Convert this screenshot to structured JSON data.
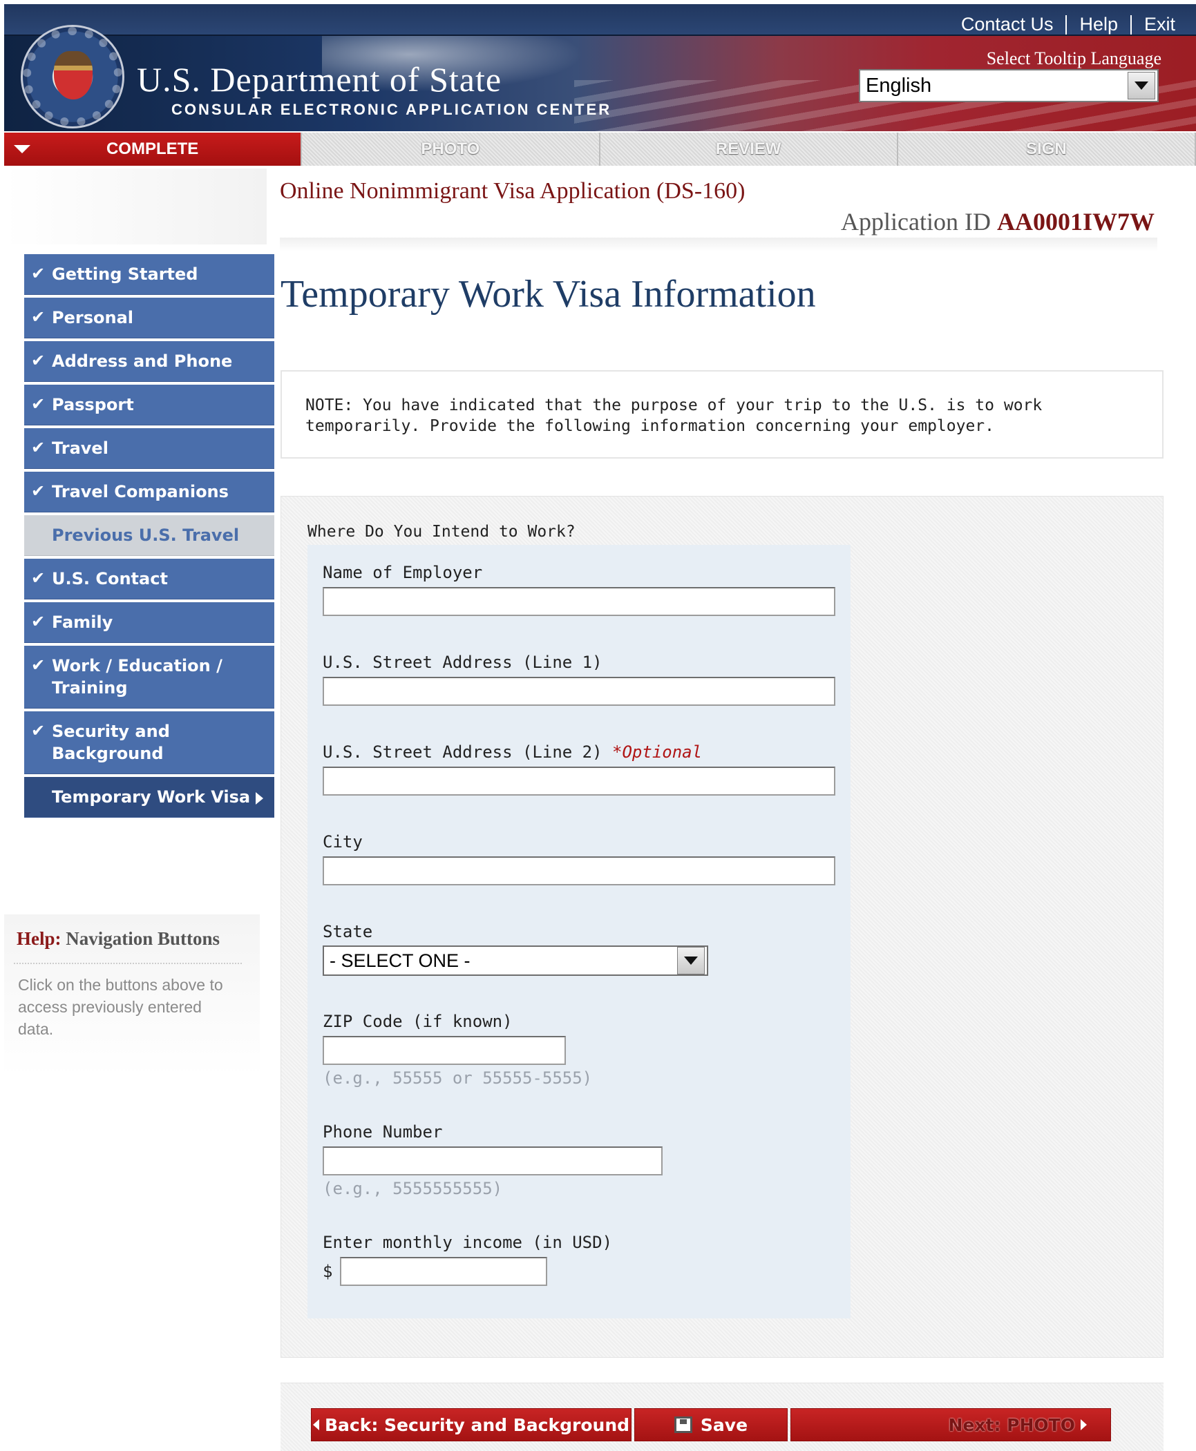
{
  "header": {
    "top_links": [
      "Contact Us",
      "Help",
      "Exit"
    ],
    "dept_title": "U.S. Department of State",
    "dept_subtitle": "CONSULAR ELECTRONIC APPLICATION CENTER",
    "tooltip_label": "Select Tooltip Language",
    "tooltip_language": "English"
  },
  "steps": [
    "COMPLETE",
    "PHOTO",
    "REVIEW",
    "SIGN"
  ],
  "title": {
    "form_name": "Online Nonimmigrant Visa Application (DS-160)",
    "app_id_label": "Application ID",
    "app_id": "AA0001IW7W"
  },
  "sidebar": {
    "items": [
      {
        "label": "Getting Started",
        "state": "done"
      },
      {
        "label": "Personal",
        "state": "done"
      },
      {
        "label": "Address and Phone",
        "state": "done"
      },
      {
        "label": "Passport",
        "state": "done"
      },
      {
        "label": "Travel",
        "state": "done"
      },
      {
        "label": "Travel Companions",
        "state": "done"
      },
      {
        "label": "Previous U.S. Travel",
        "state": "disabled"
      },
      {
        "label": "U.S. Contact",
        "state": "done"
      },
      {
        "label": "Family",
        "state": "done"
      },
      {
        "label": "Work / Education / Training",
        "state": "done"
      },
      {
        "label": "Security and Background",
        "state": "done"
      },
      {
        "label": "Temporary Work Visa",
        "state": "current"
      }
    ]
  },
  "help": {
    "title_lead": "Help:",
    "title_rest": "Navigation Buttons",
    "text": "Click on the buttons above to access previously entered data."
  },
  "main": {
    "heading": "Temporary Work Visa Information",
    "note": "NOTE: You have indicated that the purpose of your trip to the U.S. is to work temporarily. Provide the following information concerning your employer.",
    "section_title": "Where Do You Intend to Work?",
    "fields": {
      "employer_label": "Name of Employer",
      "employer_value": "",
      "street1_label": "U.S. Street Address (Line 1)",
      "street1_value": "",
      "street2_label": "U.S. Street Address (Line 2)",
      "street2_optional": "*Optional",
      "street2_value": "",
      "city_label": "City",
      "city_value": "",
      "state_label": "State",
      "state_value": "- SELECT ONE -",
      "zip_label": "ZIP Code (if known)",
      "zip_value": "",
      "zip_hint": "(e.g., 55555 or 55555-5555)",
      "phone_label": "Phone Number",
      "phone_value": "",
      "phone_hint": "(e.g., 5555555555)",
      "income_label": "Enter monthly income (in USD)",
      "income_prefix": "$",
      "income_value": ""
    }
  },
  "buttons": {
    "back": "Back: Security and Background",
    "save": "Save",
    "next": "Next: PHOTO"
  },
  "colors": {
    "nav_blue": "#4a6eab",
    "nav_current": "#2f4c80",
    "button_red": "#b51b1b",
    "title_red": "#7a1515"
  }
}
